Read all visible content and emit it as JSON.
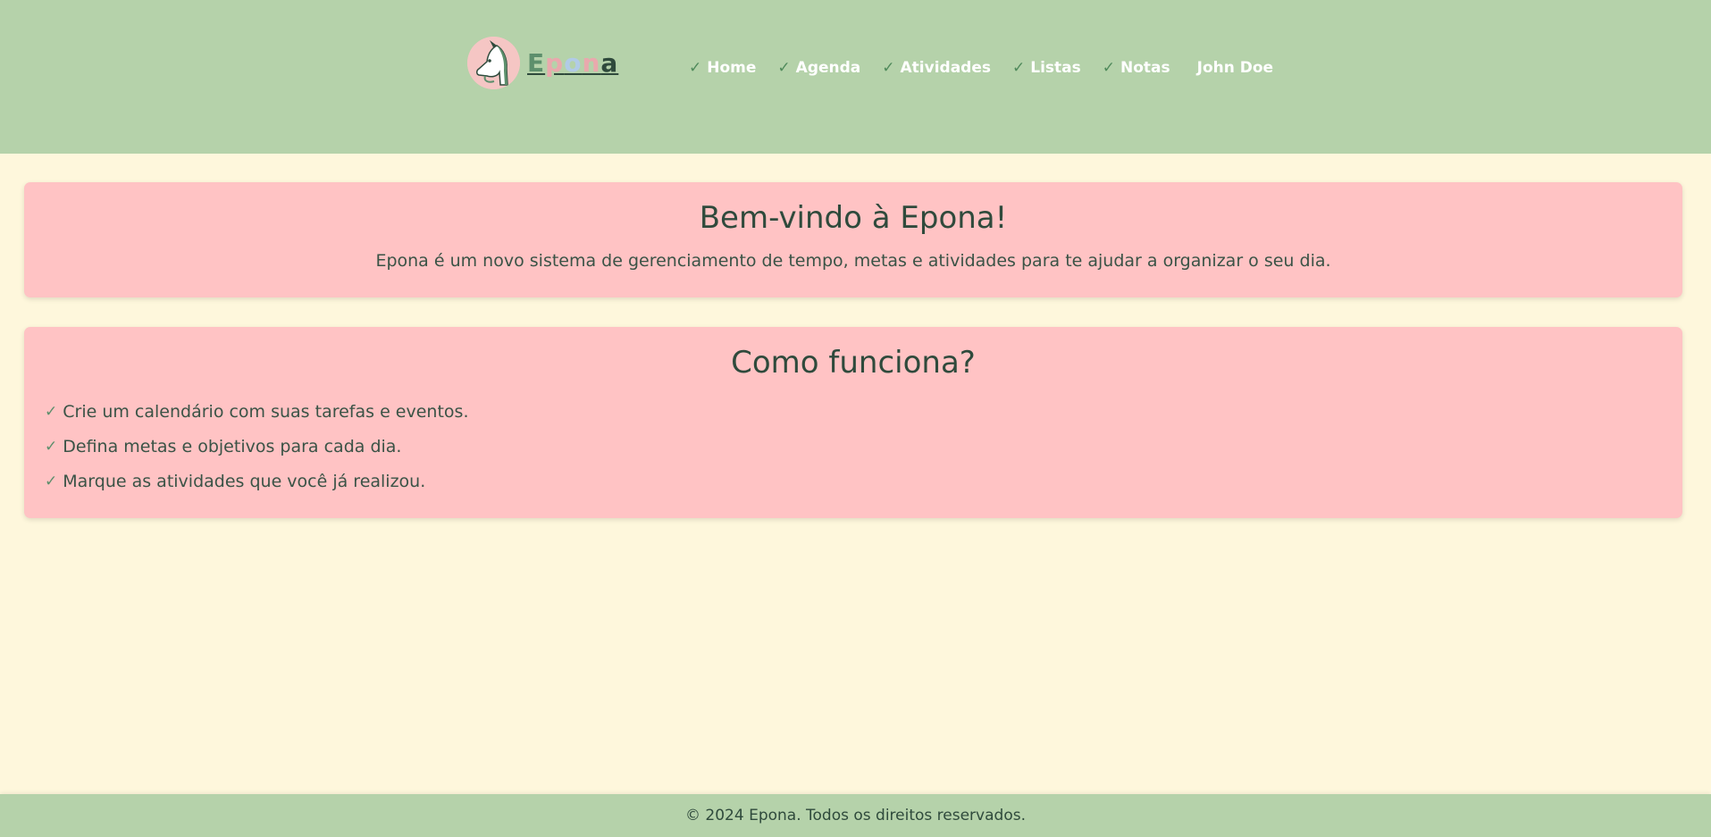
{
  "header": {
    "logo": {
      "icon": "horse-head-icon",
      "letters": [
        "E",
        "p",
        "o",
        "n",
        "a"
      ]
    },
    "nav": [
      {
        "label": "Home",
        "icon": "check-icon"
      },
      {
        "label": "Agenda",
        "icon": "check-icon"
      },
      {
        "label": "Atividades",
        "icon": "check-icon"
      },
      {
        "label": "Listas",
        "icon": "check-icon"
      },
      {
        "label": "Notas",
        "icon": "check-icon"
      }
    ],
    "user": "John Doe",
    "check_glyph": "✓"
  },
  "welcome": {
    "title": "Bem-vindo à Epona!",
    "text": "Epona é um novo sistema de gerenciamento de tempo, metas e atividades para te ajudar a organizar o seu dia."
  },
  "how": {
    "title": "Como funciona?",
    "items": [
      "Crie um calendário com suas tarefas e eventos.",
      "Defina metas e objetivos para cada dia.",
      "Marque as atividades que você já realizou."
    ]
  },
  "footer": {
    "text": "© 2024 Epona. Todos os direitos reservados."
  },
  "colors": {
    "header_bg": "#b5d2aa",
    "page_bg": "#fef7dc",
    "card_bg": "#ffc3c4",
    "text": "#2f4a3c",
    "accent": "#5d8f6c"
  }
}
